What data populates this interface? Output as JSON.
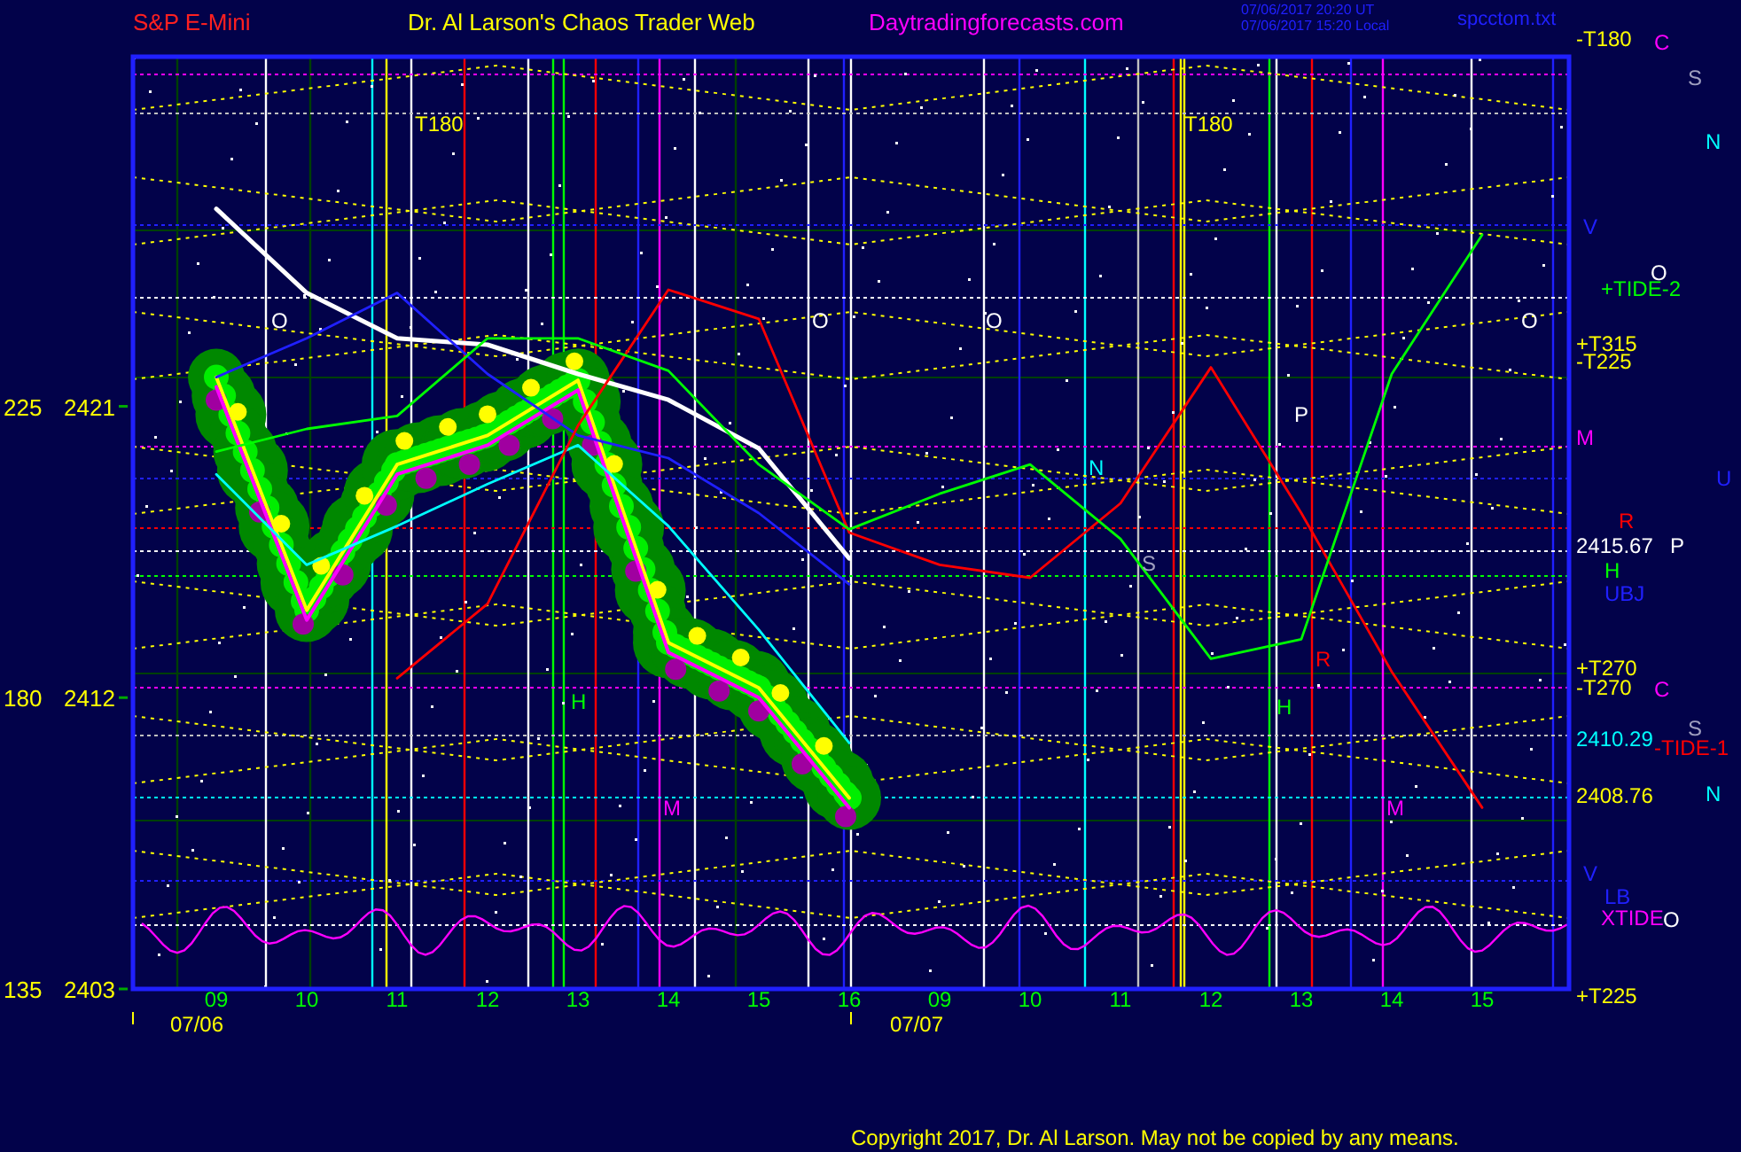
{
  "header": {
    "symbol": "S&P E-Mini",
    "title": "Dr. Al Larson's Chaos Trader Web",
    "website": "Daytradingforecasts.com",
    "time_utc": "07/06/2017 20:20 UT",
    "time_local": "07/06/2017 15:20 Local",
    "file": "spcctom.txt"
  },
  "y_angle_labels": [
    "225",
    "180",
    "135"
  ],
  "chart_data": {
    "type": "line",
    "ylim": [
      2403,
      2431.8
    ],
    "categories": [
      "09",
      "10",
      "11",
      "12",
      "13",
      "14",
      "15",
      "16",
      "09",
      "10",
      "11",
      "12",
      "13",
      "14",
      "15"
    ],
    "yticks": [
      2421,
      2412,
      2403
    ],
    "series": [
      {
        "color": "#ffff00",
        "values": [
          2421.9,
          2414.7,
          2419.2,
          2420.1,
          2421.8,
          2413.7,
          2412.3,
          2408.9,
          null,
          null,
          null,
          null,
          null,
          null,
          null
        ]
      },
      {
        "color": "#ff00ff",
        "values": [
          2421.6,
          2414.4,
          2418.9,
          2419.8,
          2421.5,
          2413.4,
          2412.0,
          2408.6,
          null,
          null,
          null,
          null,
          null,
          null,
          null
        ]
      },
      {
        "color": "#00ffff",
        "values": [
          2418.9,
          2416.1,
          2417.3,
          2418.6,
          2419.8,
          2417.3,
          2414.1,
          2410.6,
          null,
          null,
          null,
          null,
          null,
          null,
          null
        ]
      },
      {
        "color": "#ffffff",
        "values": [
          2427.1,
          2424.5,
          2423.1,
          2422.9,
          2422.0,
          2421.2,
          2419.7,
          2416.3,
          null,
          null,
          null,
          null,
          null,
          null,
          null
        ]
      },
      {
        "color": "#2020ff",
        "values": [
          2421.9,
          2423.1,
          2424.5,
          2422.0,
          2420.1,
          2419.4,
          2417.7,
          2415.5,
          null,
          null,
          null,
          null,
          null,
          null,
          null
        ]
      },
      {
        "color": "#ff0000",
        "values": [
          null,
          null,
          2412.6,
          2414.9,
          2420.4,
          2424.6,
          2423.7,
          2417.1,
          2416.1,
          2415.7,
          2418.0,
          2422.2,
          2417.7,
          2412.8,
          2408.6
        ]
      },
      {
        "color": "#00ff00",
        "values": [
          2419.6,
          2420.3,
          2420.7,
          2423.1,
          2423.1,
          2422.1,
          2419.2,
          2417.2,
          2418.3,
          2419.2,
          2416.9,
          2413.2,
          2413.8,
          2422.0,
          2426.3
        ]
      }
    ]
  },
  "date_labels": [
    "07/06",
    "07/07"
  ],
  "chart_labels": [
    {
      "text": "T180",
      "color": "#ffff00"
    },
    {
      "text": "T180",
      "color": "#ffff00"
    },
    {
      "text": "O",
      "color": "#ffffff"
    },
    {
      "text": "O",
      "color": "#ffffff"
    },
    {
      "text": "O",
      "color": "#ffffff"
    },
    {
      "text": "O",
      "color": "#ffffff"
    },
    {
      "text": "N",
      "color": "#00ffff"
    },
    {
      "text": "S",
      "color": "#a0a0c0"
    },
    {
      "text": "P",
      "color": "#ffffff"
    },
    {
      "text": "R",
      "color": "#ff0000"
    },
    {
      "text": "H",
      "color": "#00ff00"
    },
    {
      "text": "H",
      "color": "#00ff00"
    },
    {
      "text": "M",
      "color": "#ff00ff"
    },
    {
      "text": "M",
      "color": "#ff00ff"
    }
  ],
  "right_labels": [
    {
      "text": "-T180",
      "color": "#ffff00"
    },
    {
      "text": "C",
      "color": "#ff00ff"
    },
    {
      "text": "S",
      "color": "#a0a0c0"
    },
    {
      "text": "N",
      "color": "#00ffff"
    },
    {
      "text": "V",
      "color": "#2020ff"
    },
    {
      "text": "O",
      "color": "#ffffff"
    },
    {
      "text": "+TIDE-2",
      "color": "#00ff00"
    },
    {
      "text": "+T315",
      "color": "#ffff00"
    },
    {
      "text": "-T225",
      "color": "#ffff00"
    },
    {
      "text": "M",
      "color": "#ff00ff"
    },
    {
      "text": "U",
      "color": "#2020ff"
    },
    {
      "text": "R",
      "color": "#ff0000"
    },
    {
      "text": "2415.67",
      "color": "#ffffff"
    },
    {
      "text": "P",
      "color": "#ffffff"
    },
    {
      "text": "H",
      "color": "#00ff00"
    },
    {
      "text": "UBJ",
      "color": "#2020ff"
    },
    {
      "text": "+T270",
      "color": "#ffff00"
    },
    {
      "text": "-T270",
      "color": "#ffff00"
    },
    {
      "text": "C",
      "color": "#ff00ff"
    },
    {
      "text": "S",
      "color": "#a0a0c0"
    },
    {
      "text": "2410.29",
      "color": "#00ffff"
    },
    {
      "text": "-TIDE-1",
      "color": "#ff0000"
    },
    {
      "text": "N",
      "color": "#00ffff"
    },
    {
      "text": "2408.76",
      "color": "#ffff00"
    },
    {
      "text": "V",
      "color": "#2020ff"
    },
    {
      "text": "LB",
      "color": "#2020ff"
    },
    {
      "text": "XTIDE",
      "color": "#ff00ff"
    },
    {
      "text": "O",
      "color": "#ffffff"
    },
    {
      "text": "+T225",
      "color": "#ffff00"
    }
  ],
  "copyright": "Copyright 2017, Dr. Al Larson. May not be copied by any means."
}
